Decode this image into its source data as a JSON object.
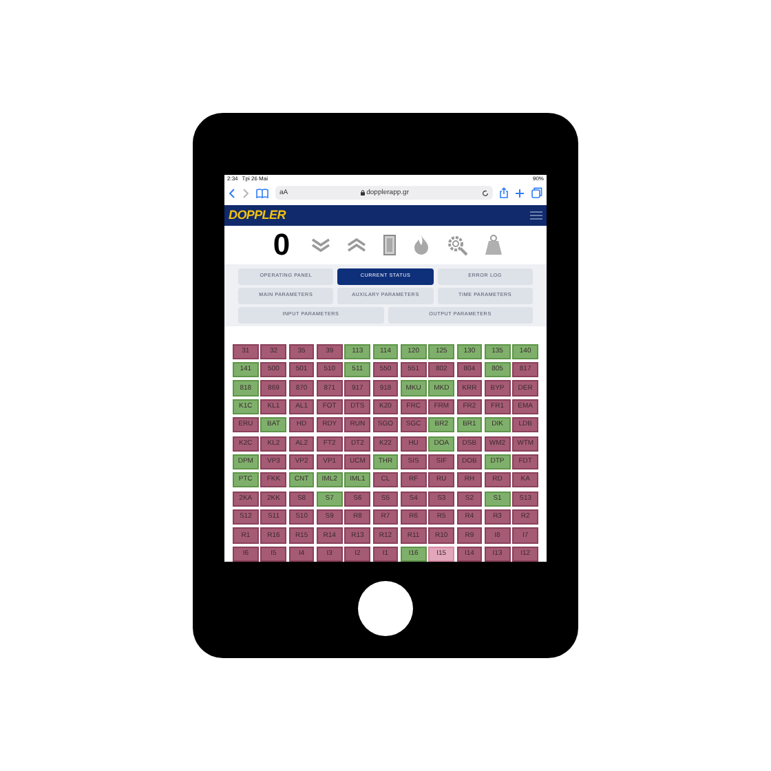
{
  "status_bar": {
    "time": "2:34",
    "date": "Tpi 26 Mai",
    "battery": "90%"
  },
  "browser": {
    "text_size": "aA",
    "url": "dopplerapp.gr"
  },
  "header": {
    "logo": "DOPPLER"
  },
  "toolbar": {
    "counter": "0"
  },
  "tabs": [
    {
      "label": "OPERATING PANEL",
      "selected": false
    },
    {
      "label": "CURRENT STATUS",
      "selected": true
    },
    {
      "label": "ERROR LOG",
      "selected": false
    },
    {
      "label": "MAIN PARAMETERS",
      "selected": false
    },
    {
      "label": "AUXILARY PARAMETERS",
      "selected": false
    },
    {
      "label": "TIME PARAMETERS",
      "selected": false
    },
    {
      "label": "INPUT PARAMETERS",
      "selected": false
    },
    {
      "label": "OUTPUT PARAMETERS",
      "selected": false
    }
  ],
  "grid": {
    "rows": [
      [
        {
          "label": "31",
          "on": false,
          "highlighted": false
        },
        {
          "label": "32",
          "on": false,
          "highlighted": false
        },
        {
          "label": "35",
          "on": false,
          "highlighted": false
        },
        {
          "label": "39",
          "on": false,
          "highlighted": false
        },
        {
          "label": "113",
          "on": true,
          "highlighted": false
        },
        {
          "label": "114",
          "on": true,
          "highlighted": false
        },
        {
          "label": "120",
          "on": true,
          "highlighted": false
        },
        {
          "label": "125",
          "on": true,
          "highlighted": false
        },
        {
          "label": "130",
          "on": true,
          "highlighted": false
        },
        {
          "label": "135",
          "on": true,
          "highlighted": false
        },
        {
          "label": "140",
          "on": true,
          "highlighted": false
        }
      ],
      [
        {
          "label": "141",
          "on": true,
          "highlighted": false
        },
        {
          "label": "500",
          "on": false,
          "highlighted": false
        },
        {
          "label": "501",
          "on": false,
          "highlighted": false
        },
        {
          "label": "510",
          "on": false,
          "highlighted": false
        },
        {
          "label": "511",
          "on": true,
          "highlighted": false
        },
        {
          "label": "550",
          "on": false,
          "highlighted": false
        },
        {
          "label": "551",
          "on": false,
          "highlighted": false
        },
        {
          "label": "802",
          "on": false,
          "highlighted": false
        },
        {
          "label": "804",
          "on": false,
          "highlighted": false
        },
        {
          "label": "805",
          "on": true,
          "highlighted": false
        },
        {
          "label": "817",
          "on": false,
          "highlighted": false
        }
      ],
      [
        {
          "label": "818",
          "on": true,
          "highlighted": false
        },
        {
          "label": "869",
          "on": false,
          "highlighted": false
        },
        {
          "label": "870",
          "on": false,
          "highlighted": false
        },
        {
          "label": "871",
          "on": false,
          "highlighted": false
        },
        {
          "label": "917",
          "on": false,
          "highlighted": false
        },
        {
          "label": "918",
          "on": false,
          "highlighted": false
        },
        {
          "label": "MKU",
          "on": true,
          "highlighted": false
        },
        {
          "label": "MKD",
          "on": true,
          "highlighted": false
        },
        {
          "label": "KRR",
          "on": false,
          "highlighted": false
        },
        {
          "label": "BYP",
          "on": false,
          "highlighted": false
        },
        {
          "label": "DER",
          "on": false,
          "highlighted": false
        }
      ],
      [
        {
          "label": "K1C",
          "on": true,
          "highlighted": false
        },
        {
          "label": "KL1",
          "on": false,
          "highlighted": false
        },
        {
          "label": "AL1",
          "on": false,
          "highlighted": false
        },
        {
          "label": "FOT",
          "on": false,
          "highlighted": false
        },
        {
          "label": "DTS",
          "on": false,
          "highlighted": false
        },
        {
          "label": "K20",
          "on": false,
          "highlighted": false
        },
        {
          "label": "FRC",
          "on": false,
          "highlighted": false
        },
        {
          "label": "FRM",
          "on": false,
          "highlighted": false
        },
        {
          "label": "FR2",
          "on": false,
          "highlighted": false
        },
        {
          "label": "FR1",
          "on": false,
          "highlighted": false
        },
        {
          "label": "EMA",
          "on": false,
          "highlighted": false
        }
      ],
      [
        {
          "label": "ERU",
          "on": false,
          "highlighted": false
        },
        {
          "label": "BAT",
          "on": true,
          "highlighted": false
        },
        {
          "label": "HD",
          "on": false,
          "highlighted": false
        },
        {
          "label": "RDY",
          "on": false,
          "highlighted": false
        },
        {
          "label": "RUN",
          "on": false,
          "highlighted": false
        },
        {
          "label": "SGO",
          "on": false,
          "highlighted": false
        },
        {
          "label": "SGC",
          "on": false,
          "highlighted": false
        },
        {
          "label": "BR2",
          "on": true,
          "highlighted": false
        },
        {
          "label": "BR1",
          "on": true,
          "highlighted": false
        },
        {
          "label": "DIK",
          "on": true,
          "highlighted": false
        },
        {
          "label": "LDB",
          "on": false,
          "highlighted": false
        }
      ],
      [
        {
          "label": "K2C",
          "on": false,
          "highlighted": false
        },
        {
          "label": "KL2",
          "on": false,
          "highlighted": false
        },
        {
          "label": "AL2",
          "on": false,
          "highlighted": false
        },
        {
          "label": "FT2",
          "on": false,
          "highlighted": false
        },
        {
          "label": "DT2",
          "on": false,
          "highlighted": false
        },
        {
          "label": "K22",
          "on": false,
          "highlighted": false
        },
        {
          "label": "HU",
          "on": false,
          "highlighted": false
        },
        {
          "label": "DOA",
          "on": true,
          "highlighted": false
        },
        {
          "label": "DSB",
          "on": false,
          "highlighted": false
        },
        {
          "label": "WM2",
          "on": false,
          "highlighted": false
        },
        {
          "label": "WTM",
          "on": false,
          "highlighted": false
        }
      ],
      [
        {
          "label": "DPM",
          "on": true,
          "highlighted": false
        },
        {
          "label": "VP3",
          "on": false,
          "highlighted": false
        },
        {
          "label": "VP2",
          "on": false,
          "highlighted": false
        },
        {
          "label": "VP1",
          "on": false,
          "highlighted": false
        },
        {
          "label": "UCM",
          "on": false,
          "highlighted": false
        },
        {
          "label": "THR",
          "on": true,
          "highlighted": false
        },
        {
          "label": "SIS",
          "on": false,
          "highlighted": false
        },
        {
          "label": "SIF",
          "on": false,
          "highlighted": false
        },
        {
          "label": "DOB",
          "on": false,
          "highlighted": false
        },
        {
          "label": "DTP",
          "on": true,
          "highlighted": false
        },
        {
          "label": "FDT",
          "on": false,
          "highlighted": false
        }
      ],
      [
        {
          "label": "PTC",
          "on": true,
          "highlighted": false
        },
        {
          "label": "FKK",
          "on": false,
          "highlighted": false
        },
        {
          "label": "CNT",
          "on": true,
          "highlighted": false
        },
        {
          "label": "IML2",
          "on": true,
          "highlighted": false
        },
        {
          "label": "IML1",
          "on": true,
          "highlighted": false
        },
        {
          "label": "CL",
          "on": false,
          "highlighted": false
        },
        {
          "label": "RF",
          "on": false,
          "highlighted": false
        },
        {
          "label": "RU",
          "on": false,
          "highlighted": false
        },
        {
          "label": "RH",
          "on": false,
          "highlighted": false
        },
        {
          "label": "RD",
          "on": false,
          "highlighted": false
        },
        {
          "label": "KA",
          "on": false,
          "highlighted": false
        }
      ],
      [
        {
          "label": "2KA",
          "on": false,
          "highlighted": false
        },
        {
          "label": "2KK",
          "on": false,
          "highlighted": false
        },
        {
          "label": "S8",
          "on": false,
          "highlighted": false
        },
        {
          "label": "S7",
          "on": true,
          "highlighted": false
        },
        {
          "label": "S6",
          "on": false,
          "highlighted": false
        },
        {
          "label": "S5",
          "on": false,
          "highlighted": false
        },
        {
          "label": "S4",
          "on": false,
          "highlighted": false
        },
        {
          "label": "S3",
          "on": false,
          "highlighted": false
        },
        {
          "label": "S2",
          "on": false,
          "highlighted": false
        },
        {
          "label": "S1",
          "on": true,
          "highlighted": false
        },
        {
          "label": "S13",
          "on": false,
          "highlighted": false
        }
      ],
      [
        {
          "label": "S12",
          "on": false,
          "highlighted": false
        },
        {
          "label": "S11",
          "on": false,
          "highlighted": false
        },
        {
          "label": "S10",
          "on": false,
          "highlighted": false
        },
        {
          "label": "S9",
          "on": false,
          "highlighted": false
        },
        {
          "label": "R8",
          "on": false,
          "highlighted": false
        },
        {
          "label": "R7",
          "on": false,
          "highlighted": false
        },
        {
          "label": "R6",
          "on": false,
          "highlighted": false
        },
        {
          "label": "R5",
          "on": false,
          "highlighted": false
        },
        {
          "label": "R4",
          "on": false,
          "highlighted": false
        },
        {
          "label": "R3",
          "on": false,
          "highlighted": false
        },
        {
          "label": "R2",
          "on": false,
          "highlighted": false
        }
      ],
      [
        {
          "label": "R1",
          "on": false,
          "highlighted": false
        },
        {
          "label": "R16",
          "on": false,
          "highlighted": false
        },
        {
          "label": "R15",
          "on": false,
          "highlighted": false
        },
        {
          "label": "R14",
          "on": false,
          "highlighted": false
        },
        {
          "label": "R13",
          "on": false,
          "highlighted": false
        },
        {
          "label": "R12",
          "on": false,
          "highlighted": false
        },
        {
          "label": "R11",
          "on": false,
          "highlighted": false
        },
        {
          "label": "R10",
          "on": false,
          "highlighted": false
        },
        {
          "label": "R9",
          "on": false,
          "highlighted": false
        },
        {
          "label": "I8",
          "on": false,
          "highlighted": false
        },
        {
          "label": "I7",
          "on": false,
          "highlighted": false
        }
      ],
      [
        {
          "label": "I6",
          "on": false,
          "highlighted": false
        },
        {
          "label": "I5",
          "on": false,
          "highlighted": false
        },
        {
          "label": "I4",
          "on": false,
          "highlighted": false
        },
        {
          "label": "I3",
          "on": false,
          "highlighted": false
        },
        {
          "label": "I2",
          "on": false,
          "highlighted": false
        },
        {
          "label": "I1",
          "on": false,
          "highlighted": false
        },
        {
          "label": "I16",
          "on": true,
          "highlighted": false
        },
        {
          "label": "I15",
          "on": false,
          "highlighted": true
        },
        {
          "label": "I14",
          "on": false,
          "highlighted": false
        },
        {
          "label": "I13",
          "on": false,
          "highlighted": false
        },
        {
          "label": "I12",
          "on": false,
          "highlighted": false
        }
      ]
    ]
  }
}
